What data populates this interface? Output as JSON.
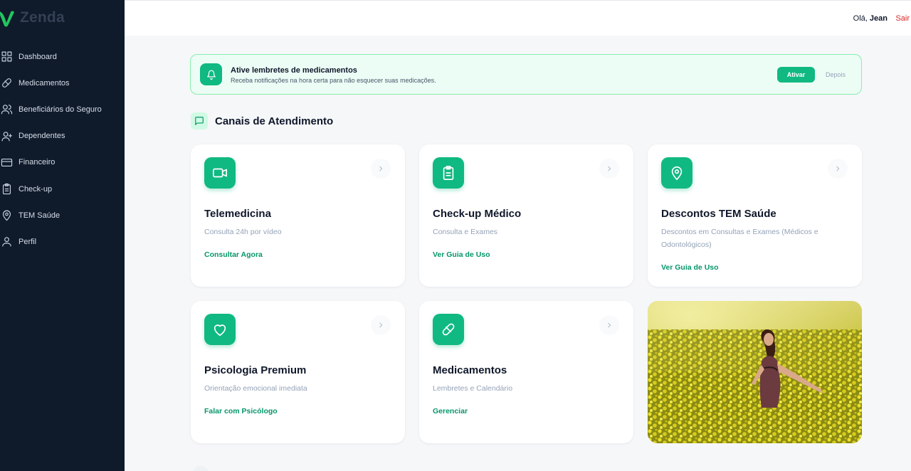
{
  "app": {
    "name": "Zenda"
  },
  "sidebar": {
    "items": [
      {
        "label": "Dashboard",
        "icon": "grid-icon"
      },
      {
        "label": "Medicamentos",
        "icon": "pill-icon"
      },
      {
        "label": "Beneficiários do Seguro",
        "icon": "users-icon"
      },
      {
        "label": "Dependentes",
        "icon": "user-icon"
      },
      {
        "label": "Financeiro",
        "icon": "credit-card-icon"
      },
      {
        "label": "Check-up",
        "icon": "clipboard-icon"
      },
      {
        "label": "TEM Saúde",
        "icon": "map-pin-icon"
      },
      {
        "label": "Perfil",
        "icon": "user-icon"
      }
    ]
  },
  "header": {
    "greeting": "Olá,",
    "user_name": "Jean",
    "logout": "Sair"
  },
  "banner": {
    "title": "Ative lembretes de medicamentos",
    "subtitle": "Receba notificações na hora certa para não esquecer suas medicações.",
    "activate_label": "Ativar",
    "later_label": "Depois",
    "icon": "bell-icon"
  },
  "section": {
    "title": "Canais de Atendimento",
    "icon": "message-square-icon"
  },
  "cards": [
    {
      "title": "Telemedicina",
      "subtitle": "Consulta 24h por vídeo",
      "link": "Consultar Agora",
      "icon": "video-icon"
    },
    {
      "title": "Check-up Médico",
      "subtitle": "Consulta e Exames",
      "link": "Ver Guia de Uso",
      "icon": "clipboard-icon"
    },
    {
      "title": "Descontos TEM Saúde",
      "subtitle": "Descontos em Consultas e Exames (Médicos e Odontológicos)",
      "link": "Ver Guia de Uso",
      "icon": "map-pin-icon"
    },
    {
      "title": "Psicologia Premium",
      "subtitle": "Orientação emocional imediata",
      "link": "Falar com Psicólogo",
      "icon": "heart-icon"
    },
    {
      "title": "Medicamentos",
      "subtitle": "Lembretes e Calendário",
      "link": "Gerenciar",
      "icon": "pill-icon"
    }
  ],
  "colors": {
    "sidebar_bg": "#0f1a2b",
    "accent": "#10b981",
    "accent_dark": "#059669",
    "logout": "#dc2626"
  }
}
